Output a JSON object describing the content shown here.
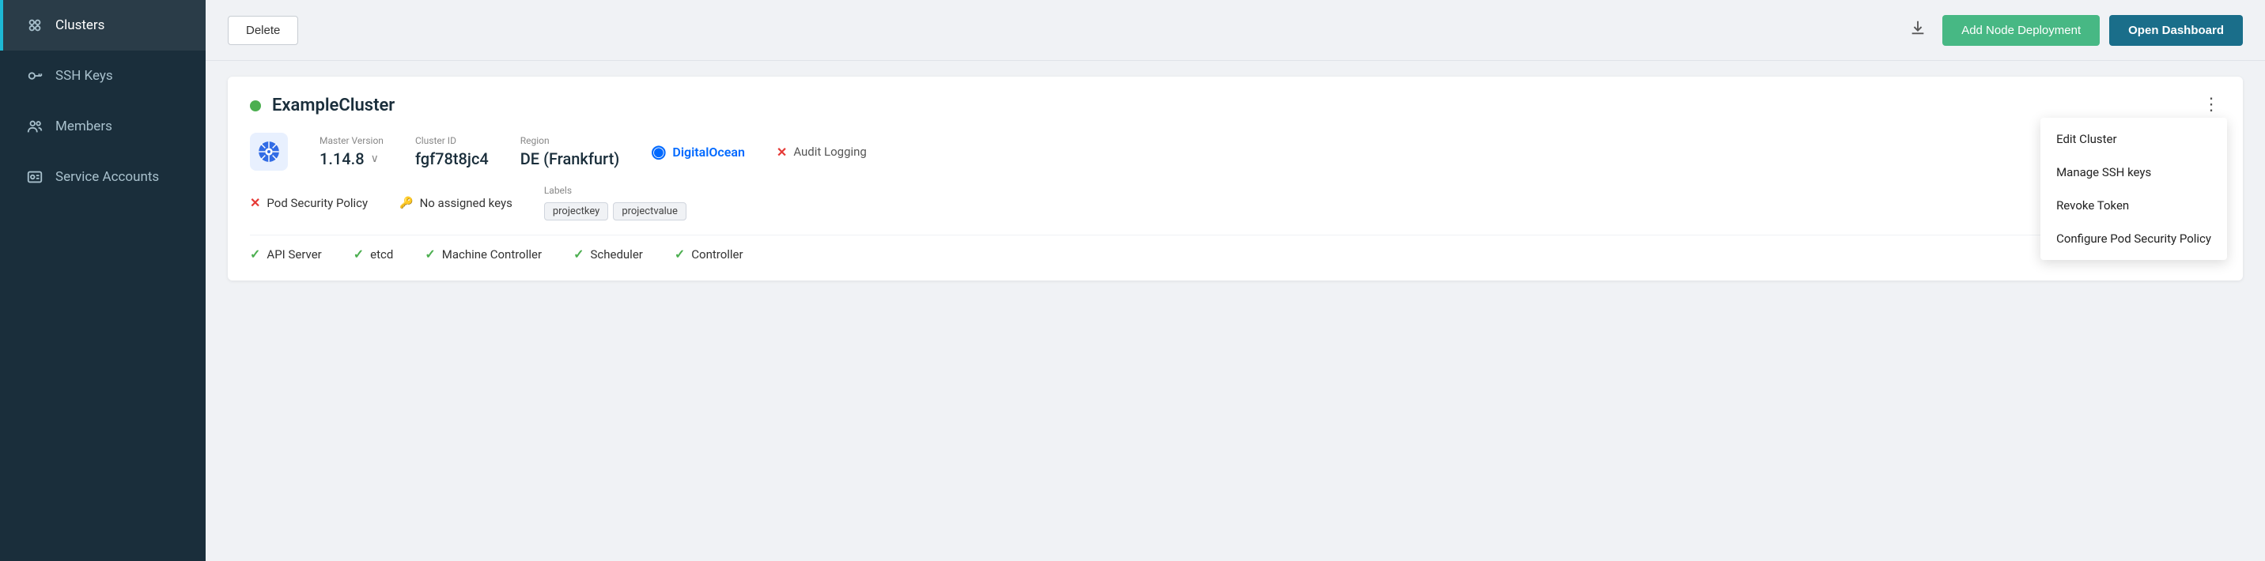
{
  "sidebar": {
    "items": [
      {
        "id": "clusters",
        "label": "Clusters",
        "active": true
      },
      {
        "id": "ssh-keys",
        "label": "SSH Keys",
        "active": false
      },
      {
        "id": "members",
        "label": "Members",
        "active": false
      },
      {
        "id": "service-accounts",
        "label": "Service Accounts",
        "active": false
      }
    ]
  },
  "toolbar": {
    "delete_label": "Delete",
    "add_node_label": "Add Node Deployment",
    "open_dashboard_label": "Open Dashboard"
  },
  "cluster": {
    "name": "ExampleCluster",
    "status": "running",
    "master_version_label": "Master Version",
    "master_version": "1.14.8",
    "cluster_id_label": "Cluster ID",
    "cluster_id": "fgf78t8jc4",
    "region_label": "Region",
    "region": "DE (Frankfurt)",
    "provider": "DigitalOcean",
    "audit_logging_label": "Audit Logging",
    "pod_security_policy_label": "Pod Security Policy",
    "no_assigned_keys_label": "No assigned keys",
    "labels_label": "Labels",
    "labels": [
      "projectkey",
      "projectvalue"
    ],
    "services": [
      {
        "label": "API Server",
        "status": "ok"
      },
      {
        "label": "etcd",
        "status": "ok"
      },
      {
        "label": "Machine Controller",
        "status": "ok"
      },
      {
        "label": "Scheduler",
        "status": "ok"
      },
      {
        "label": "Controller",
        "status": "ok"
      }
    ]
  },
  "context_menu": {
    "items": [
      "Edit Cluster",
      "Manage SSH keys",
      "Revoke Token",
      "Configure Pod Security Policy"
    ]
  }
}
